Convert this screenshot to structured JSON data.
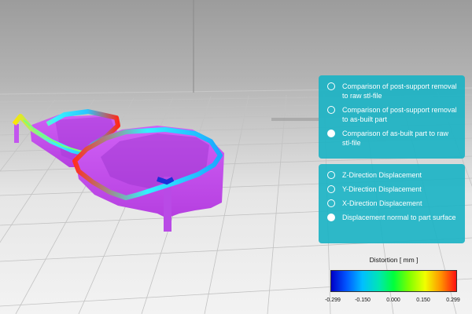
{
  "view": {
    "panel_comparison": {
      "options": [
        {
          "label": "Comparison of post-support removal to raw stl-file",
          "selected": false
        },
        {
          "label": "Comparison of post-support removal to as-built part",
          "selected": false
        },
        {
          "label": "Comparison of as-built part to raw stl-file",
          "selected": true
        }
      ]
    },
    "panel_displacement": {
      "options": [
        {
          "label": "Z-Direction Displacement",
          "selected": false
        },
        {
          "label": "Y-Direction Displacement",
          "selected": false
        },
        {
          "label": "X-Direction Displacement",
          "selected": false
        },
        {
          "label": "Displacement normal to part surface",
          "selected": true
        }
      ]
    },
    "legend": {
      "title": "Distortion [ mm ]",
      "ticks": [
        "-0.299",
        "-0.150",
        "0.000",
        "0.150",
        "0.299"
      ],
      "range": [
        -0.299,
        0.299
      ],
      "colors": [
        "#0000c8",
        "#00bfff",
        "#00ff3c",
        "#f0ff00",
        "#ff1010"
      ]
    },
    "colors": {
      "panel": "#18b2c4",
      "support": "#c84dee",
      "background": "#b9b9b9"
    }
  }
}
